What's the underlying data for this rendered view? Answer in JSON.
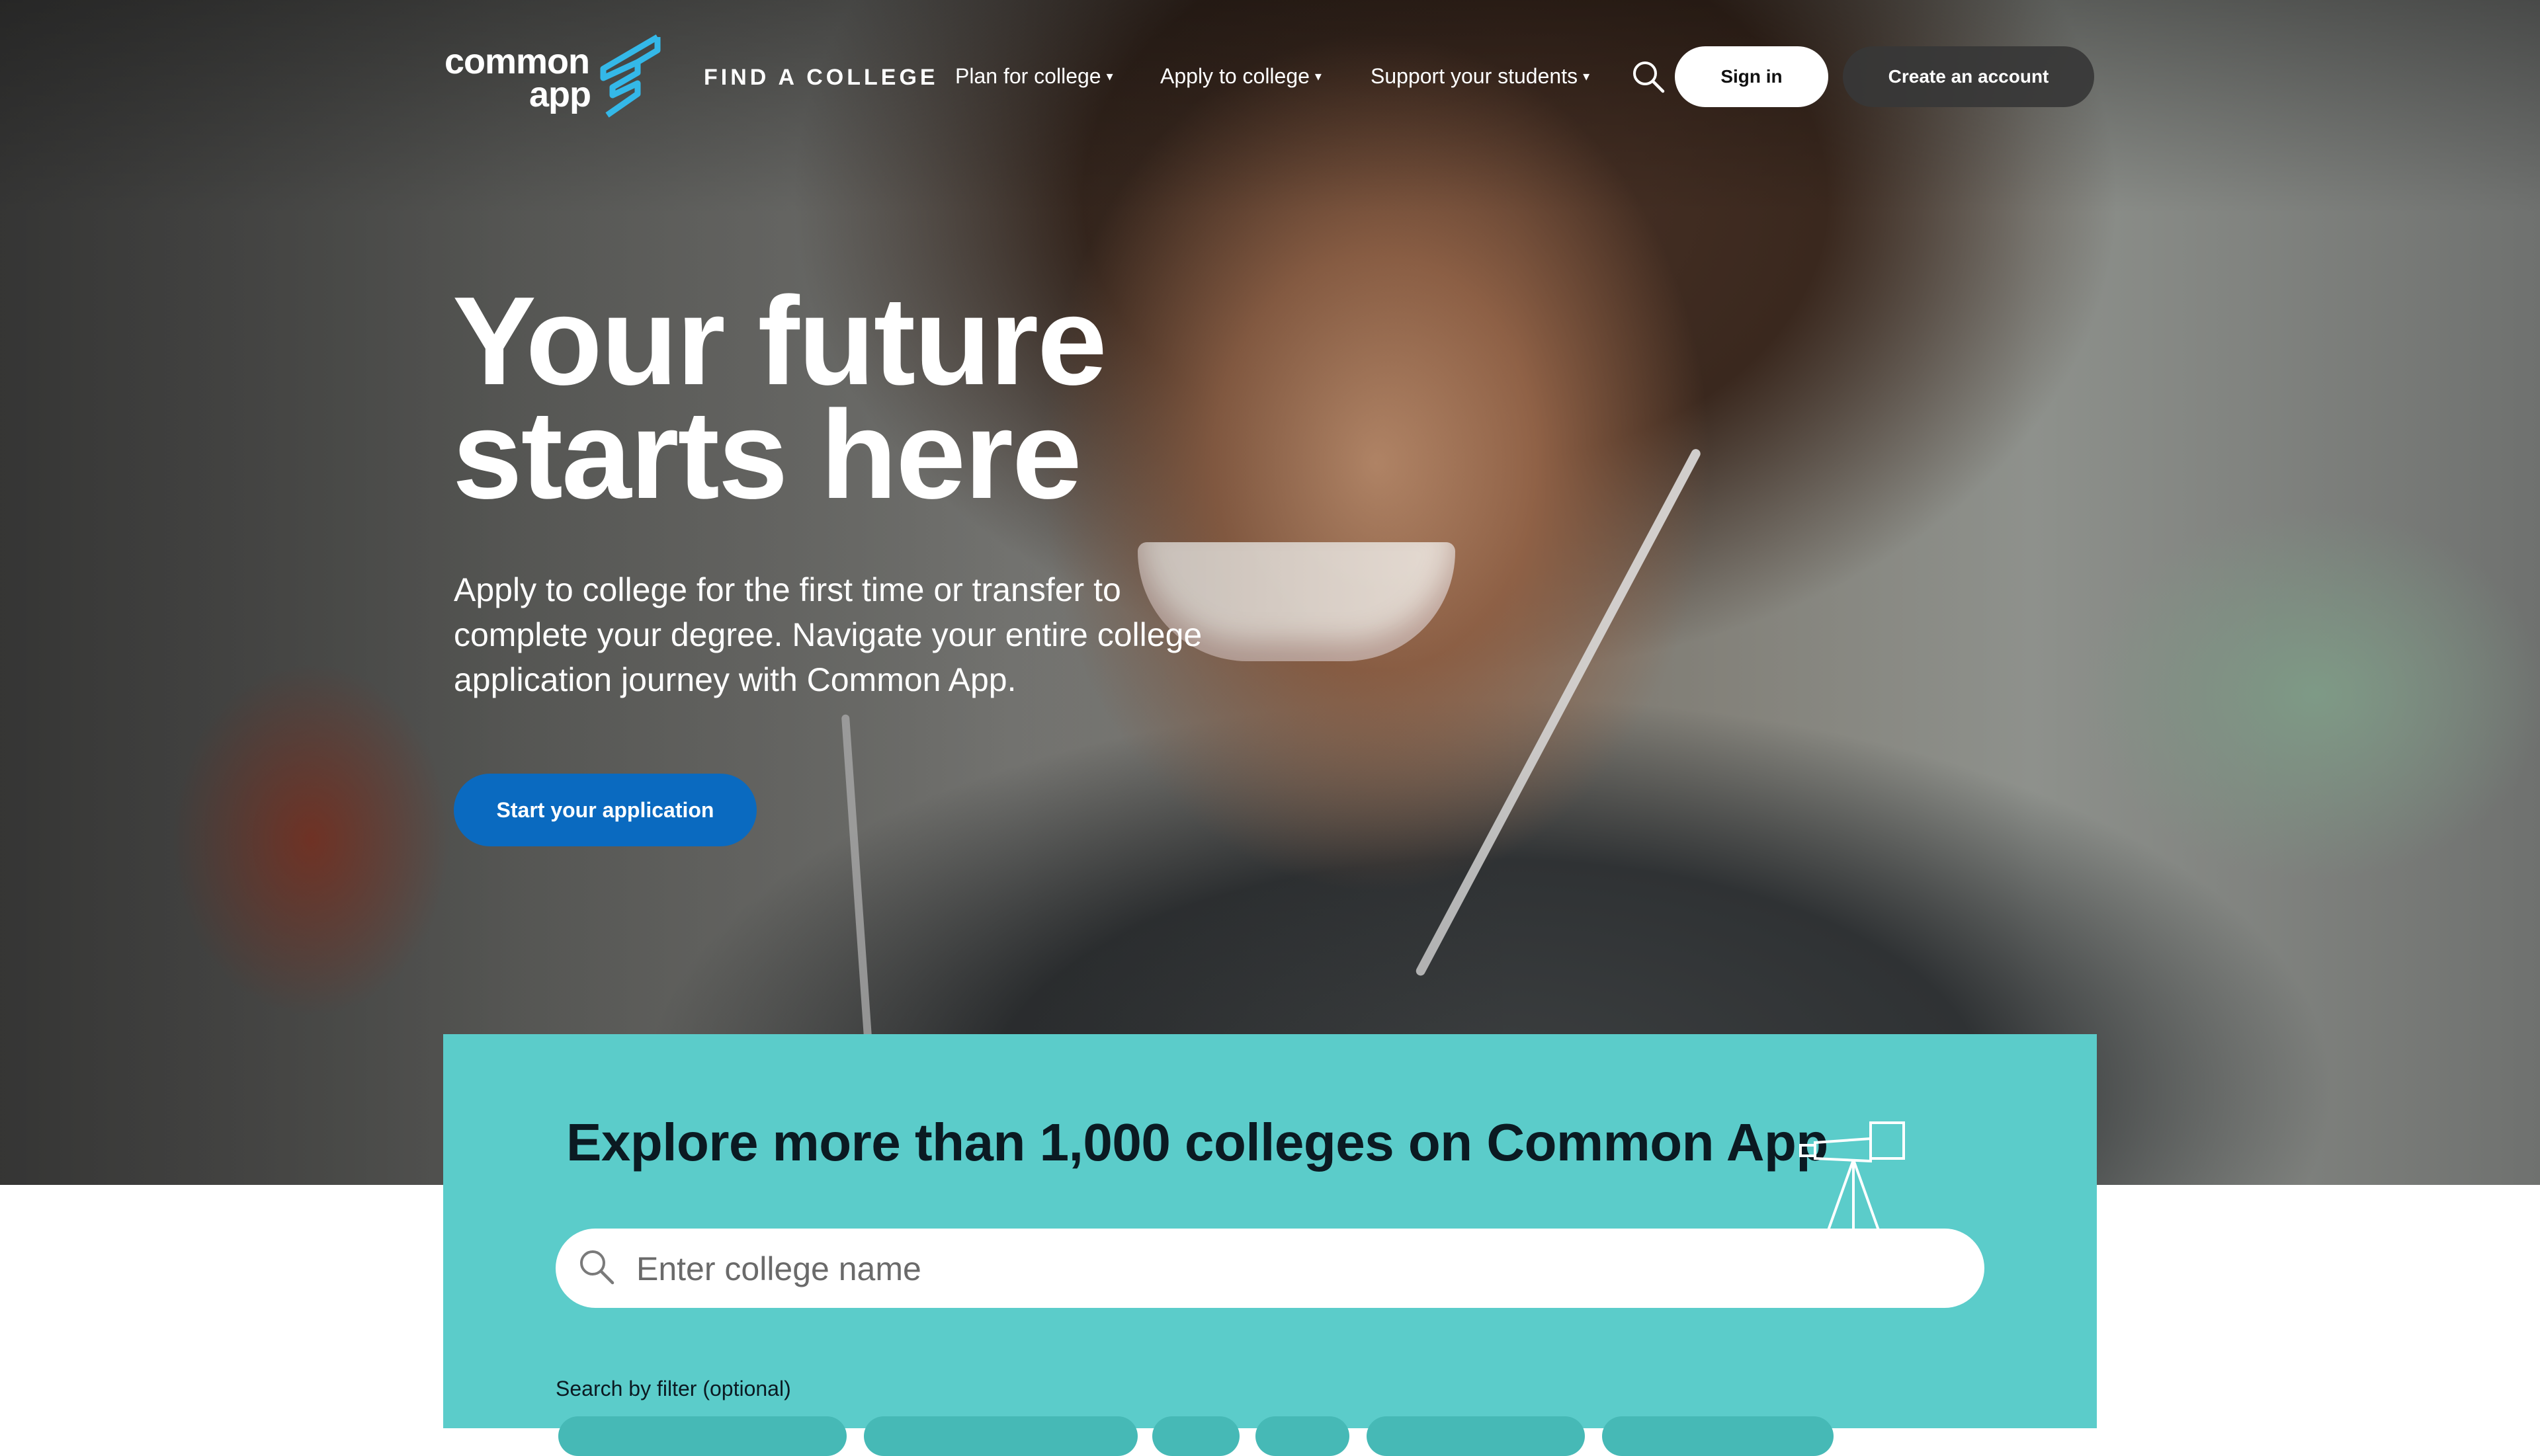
{
  "brand": {
    "logo_line1": "common",
    "logo_line2": "app",
    "logo_accent": "#34b8e8"
  },
  "nav": {
    "find_college": "FIND A COLLEGE",
    "plan": "Plan for college",
    "apply": "Apply to college",
    "support": "Support your students",
    "caret": "▾",
    "search_icon": "search-icon",
    "sign_in": "Sign in",
    "create_account": "Create an account"
  },
  "hero": {
    "title_line1": "Your future",
    "title_line2": "starts here",
    "subtitle_line1": "Apply to college for the first time or transfer to",
    "subtitle_line2": "complete your degree. Navigate your entire college",
    "subtitle_line3": "application journey with Common App.",
    "cta": "Start your application",
    "cta_color": "#0a6ac0"
  },
  "explore": {
    "title": "Explore more than 1,000 colleges on Common App",
    "icon": "telescope-icon",
    "search_placeholder": "Enter college name",
    "filter_label": "Search by filter (optional)",
    "panel_color": "#5bccca"
  }
}
